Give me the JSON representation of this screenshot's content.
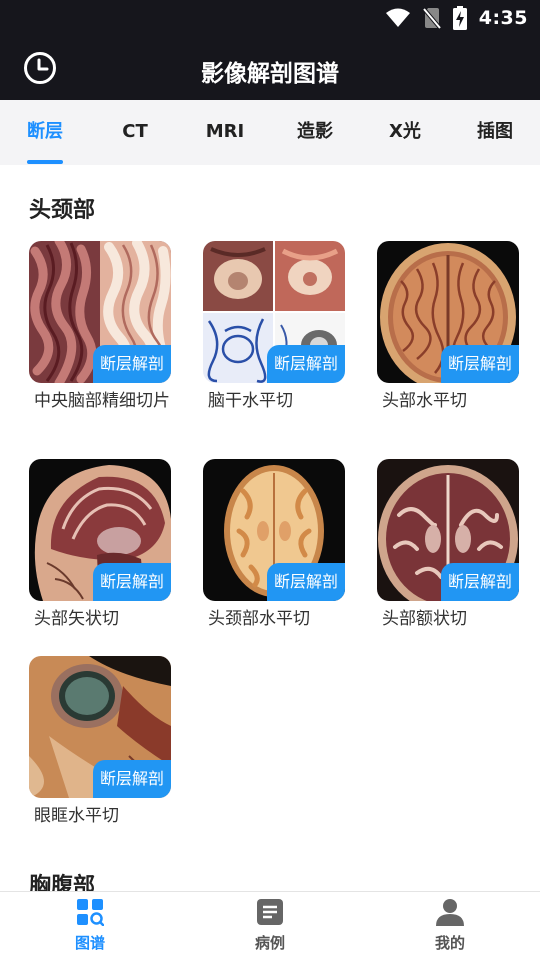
{
  "status_bar": {
    "time": "4:35"
  },
  "app_bar": {
    "title": "影像解剖图谱"
  },
  "tabs": [
    {
      "label": "断层",
      "active": true
    },
    {
      "label": "CT"
    },
    {
      "label": "MRI"
    },
    {
      "label": "造影"
    },
    {
      "label": "X光"
    },
    {
      "label": "插图"
    }
  ],
  "sections": [
    {
      "title": "头颈部",
      "cards": [
        {
          "badge": "断层解剖",
          "caption": "中央脑部精细切片",
          "image": "brain-detail-slice"
        },
        {
          "badge": "断层解剖",
          "caption": "脑干水平切",
          "image": "brainstem-axial-grid"
        },
        {
          "badge": "断层解剖",
          "caption": "头部水平切",
          "image": "head-axial-section"
        },
        {
          "badge": "断层解剖",
          "caption": "头部矢状切",
          "image": "head-sagittal-section"
        },
        {
          "badge": "断层解剖",
          "caption": "头颈部水平切",
          "image": "head-neck-axial-section"
        },
        {
          "badge": "断层解剖",
          "caption": "头部额状切",
          "image": "head-coronal-section"
        },
        {
          "badge": "断层解剖",
          "caption": "眼眶水平切",
          "image": "orbit-axial-section"
        }
      ]
    },
    {
      "title": "胸腹部"
    }
  ],
  "bottom_nav": [
    {
      "label": "图谱",
      "icon": "atlas-grid-icon",
      "active": true
    },
    {
      "label": "病例",
      "icon": "document-icon"
    },
    {
      "label": "我的",
      "icon": "profile-icon"
    }
  ],
  "colors": {
    "accent": "#1e90ff",
    "badge": "#2196f3",
    "header": "#16161c"
  }
}
